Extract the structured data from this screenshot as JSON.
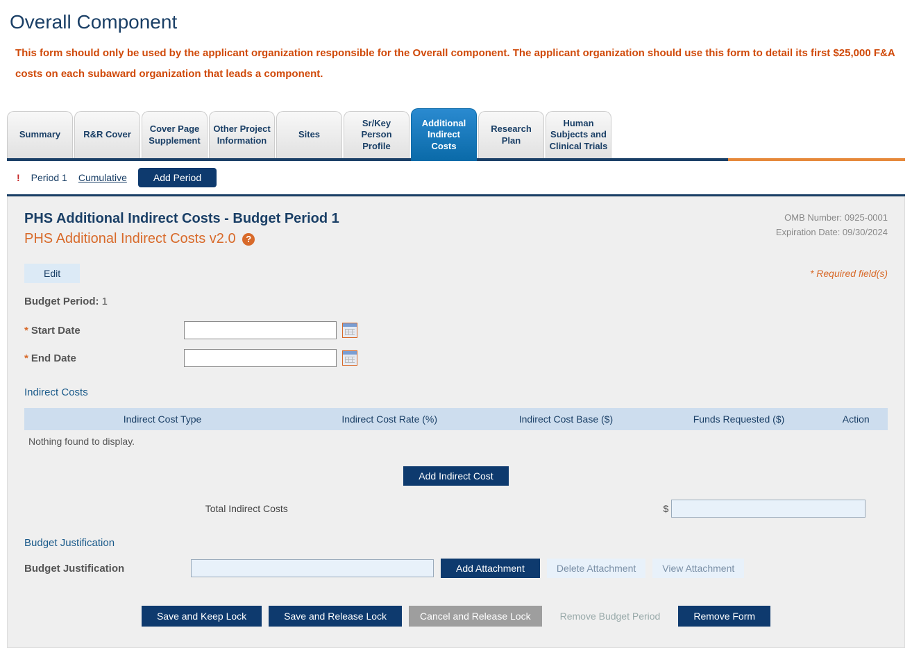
{
  "page_title": "Overall Component",
  "warning_text": "This form should only be used by the applicant organization responsible for the Overall component.  The applicant organization should use this form to detail its first $25,000 F&A costs on each subaward organization that leads a component.",
  "tabs": [
    {
      "label": "Summary",
      "active": false
    },
    {
      "label": "R&R Cover",
      "active": false
    },
    {
      "label": "Cover Page Supplement",
      "active": false
    },
    {
      "label": "Other Project Information",
      "active": false
    },
    {
      "label": "Sites",
      "active": false
    },
    {
      "label": "Sr/Key Person Profile",
      "active": false
    },
    {
      "label": "Additional Indirect Costs",
      "active": true
    },
    {
      "label": "Research Plan",
      "active": false
    },
    {
      "label": "Human Subjects and Clinical Trials",
      "active": false
    }
  ],
  "period_strip": {
    "period1": "Period 1",
    "cumulative": "Cumulative",
    "add_period": "Add Period"
  },
  "panel": {
    "title": "PHS Additional Indirect Costs - Budget Period 1",
    "subtitle": "PHS Additional Indirect Costs v2.0",
    "omb": "OMB Number: 0925-0001",
    "expiration": "Expiration Date: 09/30/2024",
    "edit_label": "Edit",
    "required_note": "* Required field(s)",
    "budget_period_label": "Budget Period:",
    "budget_period_value": "1",
    "start_date_label": "Start Date",
    "start_date_value": "",
    "end_date_label": "End Date",
    "end_date_value": "",
    "indirect_costs_header": "Indirect Costs",
    "columns": {
      "c1": "Indirect Cost Type",
      "c2": "Indirect Cost Rate (%)",
      "c3": "Indirect Cost Base ($)",
      "c4": "Funds Requested ($)",
      "c5": "Action"
    },
    "empty_message": "Nothing found to display.",
    "add_indirect_label": "Add Indirect Cost",
    "total_label": "Total Indirect Costs",
    "total_value": "",
    "budget_justification_header": "Budget Justification",
    "budget_justification_label": "Budget Justification",
    "budget_justification_value": "",
    "add_attachment": "Add Attachment",
    "delete_attachment": "Delete Attachment",
    "view_attachment": "View Attachment"
  },
  "footer": {
    "save_keep": "Save and Keep Lock",
    "save_release": "Save and Release Lock",
    "cancel_release": "Cancel and Release Lock",
    "remove_period": "Remove Budget Period",
    "remove_form": "Remove Form"
  }
}
